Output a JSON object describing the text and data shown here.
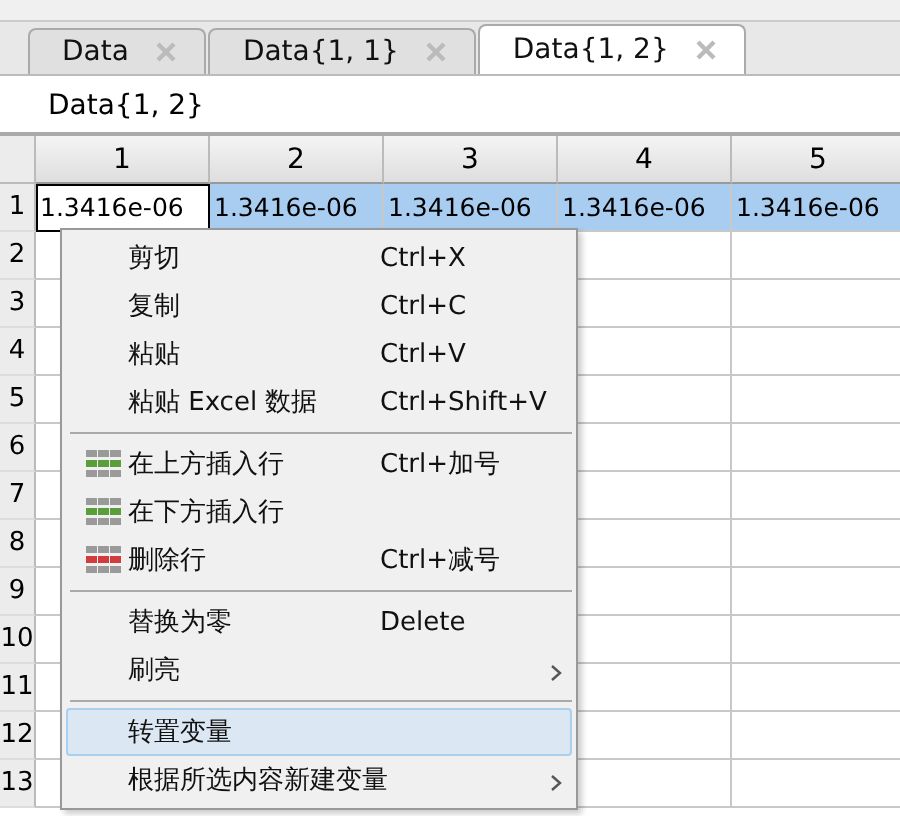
{
  "tabs": [
    {
      "label": "Data",
      "selected": false
    },
    {
      "label": "Data{1, 1}",
      "selected": false
    },
    {
      "label": "Data{1, 2}",
      "selected": true
    }
  ],
  "name_field": {
    "value": "Data{1, 2}"
  },
  "grid": {
    "columns": [
      "1",
      "2",
      "3",
      "4",
      "5"
    ],
    "rows": [
      {
        "label": "1",
        "cells": [
          {
            "value": "1.3416e-06",
            "selected": false
          },
          {
            "value": "1.3416e-06",
            "selected": true
          },
          {
            "value": "1.3416e-06",
            "selected": true
          },
          {
            "value": "1.3416e-06",
            "selected": true
          },
          {
            "value": "1.3416e-06",
            "selected": true
          }
        ]
      },
      {
        "label": "2"
      },
      {
        "label": "3"
      },
      {
        "label": "4"
      },
      {
        "label": "5"
      },
      {
        "label": "6"
      },
      {
        "label": "7"
      },
      {
        "label": "8"
      },
      {
        "label": "9"
      },
      {
        "label": "10"
      },
      {
        "label": "11"
      },
      {
        "label": "12"
      },
      {
        "label": "13"
      }
    ]
  },
  "context_menu": {
    "items": [
      {
        "kind": "item",
        "label": "剪切",
        "shortcut": "Ctrl+X",
        "selected": false
      },
      {
        "kind": "item",
        "label": "复制",
        "shortcut": "Ctrl+C",
        "selected": false
      },
      {
        "kind": "item",
        "label": "粘贴",
        "shortcut": "Ctrl+V",
        "selected": false
      },
      {
        "kind": "item",
        "label": "粘贴 Excel 数据",
        "shortcut": "Ctrl+Shift+V",
        "selected": false
      },
      {
        "kind": "separator"
      },
      {
        "kind": "insert",
        "label": "在上方插入行",
        "shortcut": "Ctrl+加号",
        "selected": false
      },
      {
        "kind": "insert",
        "label": "在下方插入行",
        "selected": false
      },
      {
        "kind": "remove",
        "label": "删除行",
        "shortcut": "Ctrl+减号",
        "selected": false
      },
      {
        "kind": "separator"
      },
      {
        "kind": "item",
        "label": "替换为零",
        "shortcut": "Delete",
        "selected": false
      },
      {
        "kind": "item",
        "label": "刷亮",
        "submenu": true,
        "selected": false
      },
      {
        "kind": "separator"
      },
      {
        "kind": "item",
        "label": "转置变量",
        "selected": true
      },
      {
        "kind": "item",
        "label": "根据所选内容新建变量",
        "submenu": true,
        "selected": false
      }
    ]
  }
}
